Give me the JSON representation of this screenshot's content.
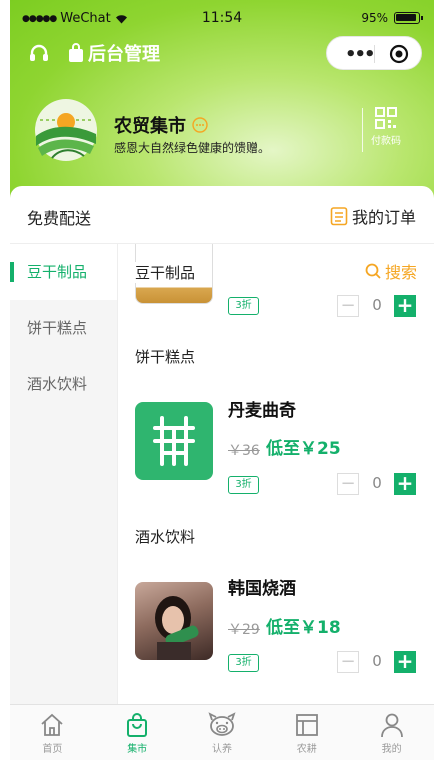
{
  "statusbar": {
    "carrier": "WeChat",
    "time": "11:54",
    "battery": "95%",
    "battery_level": 0.95
  },
  "nav": {
    "title": "后台管理",
    "headset_icon": "headset-icon",
    "bag_icon": "bag-icon",
    "more_icon": "more-dots-icon",
    "close_icon": "target-icon"
  },
  "shop": {
    "name": "农贸集市",
    "description": "感恩大自然绿色健康的馈赠。",
    "pay_label": "付款码"
  },
  "card": {
    "free_delivery": "免费配送",
    "my_orders": "我的订单"
  },
  "categories": [
    {
      "label": "豆干制品",
      "active": true
    },
    {
      "label": "饼干糕点",
      "active": false
    },
    {
      "label": "酒水饮料",
      "active": false
    }
  ],
  "content": {
    "search_label": "搜索",
    "sections": [
      {
        "title": "豆干制品"
      },
      {
        "title": "饼干糕点"
      },
      {
        "title": "酒水饮料"
      }
    ],
    "products": [
      {
        "name": "",
        "price_old": "",
        "price_now": "",
        "discount": "3折",
        "qty": "0"
      },
      {
        "name": "丹麦曲奇",
        "price_old": "￥36",
        "price_now": "低至￥25",
        "discount": "3折",
        "qty": "0"
      },
      {
        "name": "韩国烧酒",
        "price_old": "￥29",
        "price_now": "低至￥18",
        "discount": "3折",
        "qty": "0"
      }
    ]
  },
  "tabbar": [
    {
      "label": "首页",
      "icon": "home-icon",
      "active": false
    },
    {
      "label": "集市",
      "icon": "shopping-bag-icon",
      "active": true
    },
    {
      "label": "认养",
      "icon": "pig-icon",
      "active": false
    },
    {
      "label": "农耕",
      "icon": "layout-icon",
      "active": false
    },
    {
      "label": "我的",
      "icon": "user-icon",
      "active": false
    }
  ],
  "colors": {
    "accent": "#14b06b",
    "header_green": "#7ccd21",
    "search_orange": "#f5a623"
  }
}
